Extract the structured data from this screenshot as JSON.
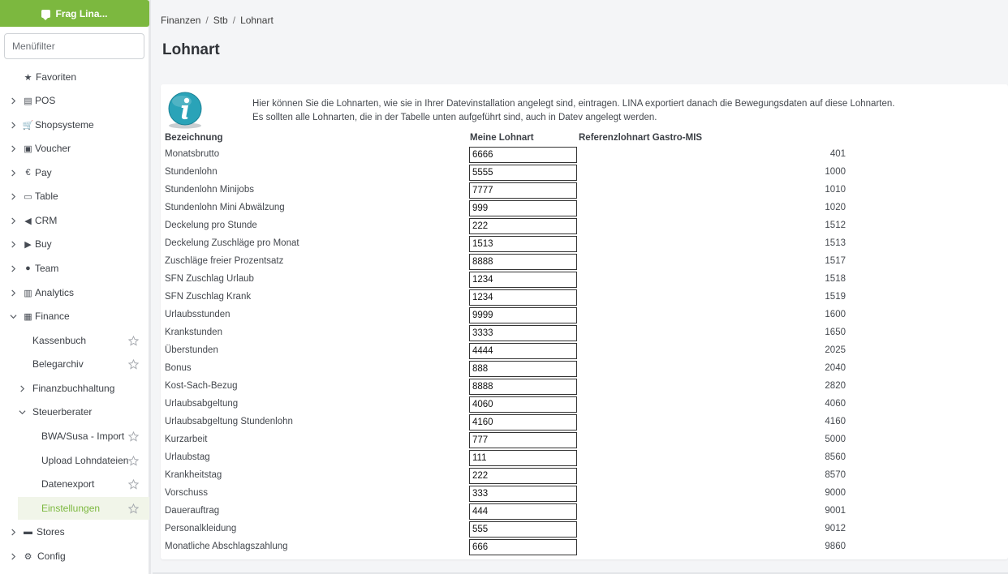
{
  "sidebar": {
    "ask_button": "Frag Lina...",
    "filter_placeholder": "Menüfilter",
    "items": [
      {
        "label": "Favoriten",
        "icon": "star-icon",
        "glyph": "★"
      },
      {
        "label": "POS",
        "icon": "register-icon",
        "glyph": "▤"
      },
      {
        "label": "Shopsysteme",
        "icon": "cart-icon",
        "glyph": "🛒"
      },
      {
        "label": "Voucher",
        "icon": "gift-icon",
        "glyph": "▣"
      },
      {
        "label": "Pay",
        "icon": "euro-icon",
        "glyph": "€"
      },
      {
        "label": "Table",
        "icon": "book-icon",
        "glyph": "▭"
      },
      {
        "label": "CRM",
        "icon": "megaphone-icon",
        "glyph": "◀"
      },
      {
        "label": "Buy",
        "icon": "truck-icon",
        "glyph": "▶"
      },
      {
        "label": "Team",
        "icon": "users-icon",
        "glyph": "●"
      },
      {
        "label": "Analytics",
        "icon": "chart-icon",
        "glyph": "▥"
      },
      {
        "label": "Finance",
        "icon": "calculator-icon",
        "glyph": "▦"
      }
    ],
    "finance_children": [
      {
        "label": "Kassenbuch"
      },
      {
        "label": "Belegarchiv"
      },
      {
        "label": "Finanzbuchhaltung"
      },
      {
        "label": "Steuerberater"
      }
    ],
    "steuerberater_children": [
      {
        "label": "BWA/Susa - Import"
      },
      {
        "label": "Upload Lohndateien"
      },
      {
        "label": "Datenexport"
      },
      {
        "label": "Einstellungen"
      }
    ],
    "bottom_items": [
      {
        "label": "Stores",
        "icon": "store-icon",
        "glyph": "▬"
      },
      {
        "label": "Config",
        "icon": "gears-icon",
        "glyph": "⚙"
      }
    ]
  },
  "breadcrumb": [
    "Finanzen",
    "Stb",
    "Lohnart"
  ],
  "page_title": "Lohnart",
  "info": {
    "line1": "Hier können Sie die Lohnarten, wie sie in Ihrer Datevinstallation angelegt sind, eintragen. LINA exportiert danach die Bewegungsdaten auf diese Lohnarten.",
    "line2": "Es sollten alle Lohnarten, die in der Tabelle unten aufgeführt sind, auch in Datev angelegt werden."
  },
  "table": {
    "headers": [
      "Bezeichnung",
      "Meine Lohnart",
      "Referenzlohnart Gastro-MIS"
    ],
    "rows": [
      {
        "label": "Monatsbrutto",
        "value": "6666",
        "ref": "401"
      },
      {
        "label": "Stundenlohn",
        "value": "5555",
        "ref": "1000"
      },
      {
        "label": "Stundenlohn Minijobs",
        "value": "7777",
        "ref": "1010"
      },
      {
        "label": "Stundenlohn Mini Abwälzung",
        "value": "999",
        "ref": "1020"
      },
      {
        "label": "Deckelung pro Stunde",
        "value": "222",
        "ref": "1512"
      },
      {
        "label": "Deckelung Zuschläge pro Monat",
        "value": "1513",
        "ref": "1513"
      },
      {
        "label": "Zuschläge freier Prozentsatz",
        "value": "8888",
        "ref": "1517"
      },
      {
        "label": "SFN Zuschlag Urlaub",
        "value": "1234",
        "ref": "1518"
      },
      {
        "label": "SFN Zuschlag Krank",
        "value": "1234",
        "ref": "1519"
      },
      {
        "label": "Urlaubsstunden",
        "value": "9999",
        "ref": "1600"
      },
      {
        "label": "Krankstunden",
        "value": "3333",
        "ref": "1650"
      },
      {
        "label": "Überstunden",
        "value": "4444",
        "ref": "2025"
      },
      {
        "label": "Bonus",
        "value": "888",
        "ref": "2040"
      },
      {
        "label": "Kost-Sach-Bezug",
        "value": "8888",
        "ref": "2820"
      },
      {
        "label": "Urlaubsabgeltung",
        "value": "4060",
        "ref": "4060"
      },
      {
        "label": "Urlaubsabgeltung Stundenlohn",
        "value": "4160",
        "ref": "4160"
      },
      {
        "label": "Kurzarbeit",
        "value": "777",
        "ref": "5000"
      },
      {
        "label": "Urlaubstag",
        "value": "111",
        "ref": "8560"
      },
      {
        "label": "Krankheitstag",
        "value": "222",
        "ref": "8570"
      },
      {
        "label": "Vorschuss",
        "value": "333",
        "ref": "9000"
      },
      {
        "label": "Dauerauftrag",
        "value": "444",
        "ref": "9001"
      },
      {
        "label": "Personalkleidung",
        "value": "555",
        "ref": "9012"
      },
      {
        "label": "Monatliche Abschlagszahlung",
        "value": "666",
        "ref": "9860"
      }
    ]
  },
  "colors": {
    "accent": "#7cb83f",
    "active_bg": "#f1f5e9",
    "info_icon": "#2aa3b8"
  }
}
